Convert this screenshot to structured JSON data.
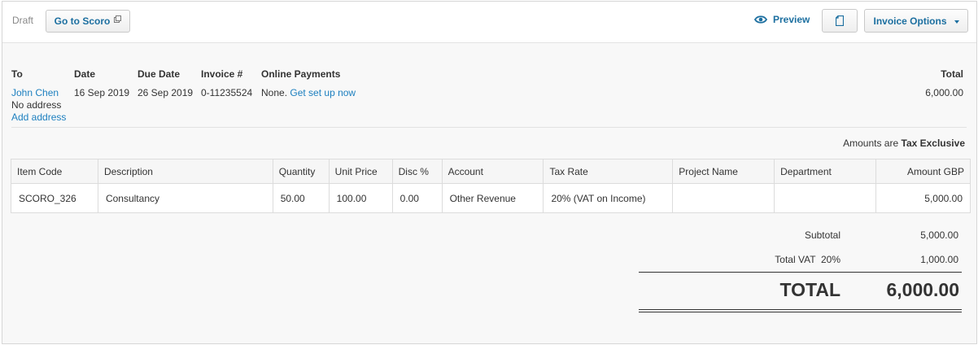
{
  "toolbar": {
    "status": "Draft",
    "go_to_scoro": "Go to Scoro",
    "preview": "Preview",
    "invoice_options": "Invoice Options"
  },
  "header": {
    "to_label": "To",
    "date_label": "Date",
    "due_date_label": "Due Date",
    "invoice_label": "Invoice #",
    "online_payments_label": "Online Payments",
    "total_label": "Total",
    "contact": "John Chen",
    "no_address": "No address",
    "add_address": "Add address",
    "date": "16 Sep 2019",
    "due_date": "26 Sep 2019",
    "invoice_number": "0-11235524",
    "online_payments_value": "None.",
    "get_set_up": "Get set up now",
    "total": "6,000.00"
  },
  "amounts_note": {
    "prefix": "Amounts are",
    "mode": "Tax Exclusive"
  },
  "table": {
    "columns": [
      "Item Code",
      "Description",
      "Quantity",
      "Unit Price",
      "Disc %",
      "Account",
      "Tax Rate",
      "Project Name",
      "Department",
      "Amount GBP"
    ],
    "rows": [
      {
        "item_code": "SCORO_326",
        "description": "Consultancy",
        "quantity": "50.00",
        "unit_price": "100.00",
        "disc": "0.00",
        "account": "Other Revenue",
        "tax_rate": "20% (VAT on Income)",
        "project_name": "",
        "department": "",
        "amount": "5,000.00"
      }
    ]
  },
  "totals": {
    "subtotal_label": "Subtotal",
    "subtotal": "5,000.00",
    "vat_label": "Total VAT  20%",
    "vat": "1,000.00",
    "total_label": "TOTAL",
    "total": "6,000.00"
  },
  "colors": {
    "link": "#1c7fbf",
    "button_text": "#1c6fa0"
  }
}
